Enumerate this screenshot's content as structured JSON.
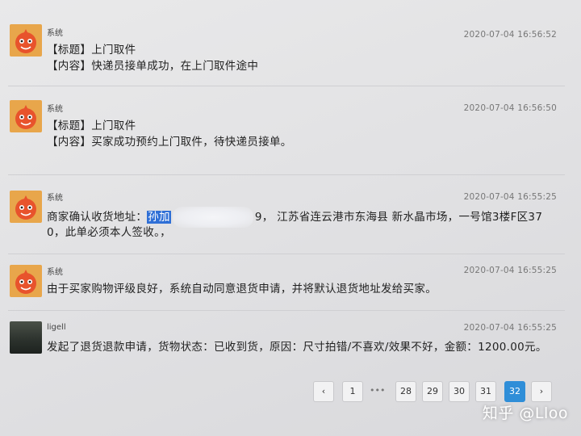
{
  "messages": [
    {
      "sender": "系统",
      "time": "2020-07-04 16:56:52",
      "line1": "【标题】上门取件",
      "line2": "【内容】快递员接单成功，在上门取件途中"
    },
    {
      "sender": "系统",
      "time": "2020-07-04 16:56:50",
      "line1": "【标题】上门取件",
      "line2": "【内容】买家成功预约上门取件，待快递员接单。"
    },
    {
      "sender": "系统",
      "time": "2020-07-04 16:55:25",
      "line1_prefix": "商家确认收货地址：",
      "line1_highlight": "孙加",
      "line1_after_blur": "9，  江苏省连云港市东海县     新水晶市场，一号馆3楼F区37",
      "line2": "0，此单必须本人签收。，"
    },
    {
      "sender": "系统",
      "time": "2020-07-04 16:55:25",
      "line1": "由于买家购物评级良好，系统自动同意退货申请，并将默认退货地址发给买家。"
    },
    {
      "sender": "ligell",
      "time": "2020-07-04 16:55:25",
      "line1": "发起了退货退款申请，货物状态：已收到货，原因：尺寸拍错/不喜欢/效果不好，金额：1200.00元。"
    }
  ],
  "pagination": {
    "prev": "‹",
    "first": "1",
    "dots": "•••",
    "pages": [
      "28",
      "29",
      "30",
      "31",
      "32"
    ],
    "active": "32",
    "next": "›"
  },
  "watermark": "知乎 @Lloo",
  "colors": {
    "accent": "#2f8ed8",
    "avatar_orange": "#e8a64b"
  }
}
